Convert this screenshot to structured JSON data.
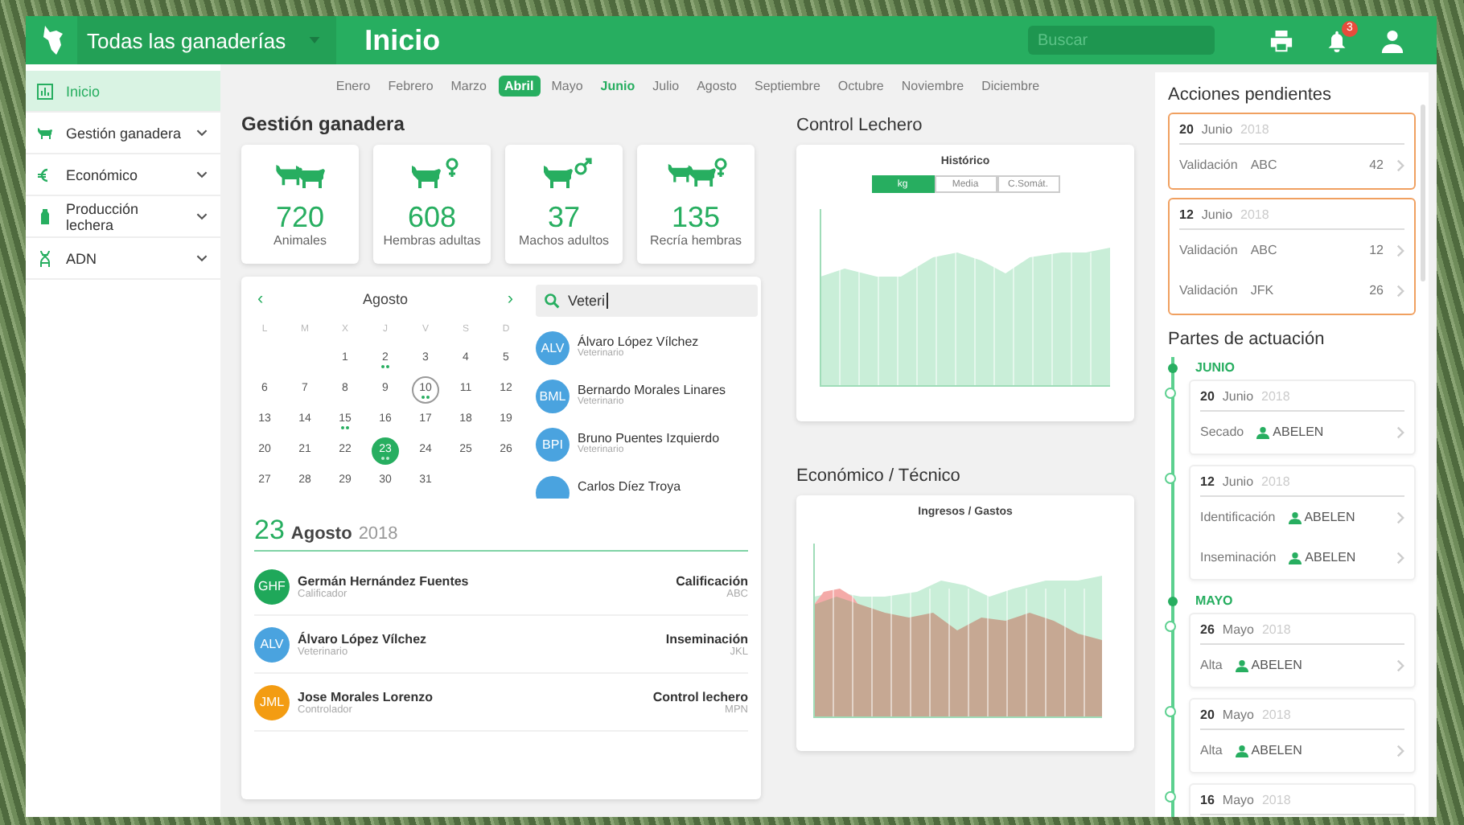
{
  "topbar": {
    "farm_selector": "Todas las ganaderías",
    "title": "Inicio",
    "search": {
      "placeholder": "Buscar"
    },
    "notifications": "3"
  },
  "sidebar": {
    "items": [
      {
        "label": "Inicio",
        "selected": true,
        "expandable": false
      },
      {
        "label": "Gestión ganadera",
        "selected": false,
        "expandable": true
      },
      {
        "label": "Económico",
        "selected": false,
        "expandable": true
      },
      {
        "label": "Producción lechera",
        "selected": false,
        "expandable": true
      },
      {
        "label": "ADN",
        "selected": false,
        "expandable": true
      }
    ]
  },
  "months": [
    {
      "label": "Enero",
      "selected": false,
      "current": false
    },
    {
      "label": "Febrero",
      "selected": false,
      "current": false
    },
    {
      "label": "Marzo",
      "selected": false,
      "current": false
    },
    {
      "label": "Abril",
      "selected": true,
      "current": false
    },
    {
      "label": "Mayo",
      "selected": false,
      "current": false
    },
    {
      "label": "Junio",
      "selected": false,
      "current": true
    },
    {
      "label": "Julio",
      "selected": false,
      "current": false
    },
    {
      "label": "Agosto",
      "selected": false,
      "current": false
    },
    {
      "label": "Septiembre",
      "selected": false,
      "current": false
    },
    {
      "label": "Octubre",
      "selected": false,
      "current": false
    },
    {
      "label": "Noviembre",
      "selected": false,
      "current": false
    },
    {
      "label": "Diciembre",
      "selected": false,
      "current": false
    }
  ],
  "gestion": {
    "title": "Gestión ganadera",
    "stats": [
      {
        "value": "720",
        "label": "Animales"
      },
      {
        "value": "608",
        "label": "Hembras adultas"
      },
      {
        "value": "37",
        "label": "Machos adultos"
      },
      {
        "value": "135",
        "label": "Recría hembras"
      }
    ]
  },
  "calendar": {
    "month": "Agosto",
    "prev": "‹",
    "next": "›",
    "weekdays": [
      "L",
      "M",
      "X",
      "J",
      "V",
      "S",
      "D"
    ],
    "days": [
      {
        "kind": "empty"
      },
      {
        "kind": "empty"
      },
      {
        "kind": "day",
        "label": "1",
        "has_events": false,
        "today": false,
        "selected": false
      },
      {
        "kind": "day",
        "label": "2",
        "has_events": true,
        "today": false,
        "selected": false
      },
      {
        "kind": "day",
        "label": "3",
        "has_events": false,
        "today": false,
        "selected": false
      },
      {
        "kind": "day",
        "label": "4",
        "has_events": false,
        "today": false,
        "selected": false
      },
      {
        "kind": "day",
        "label": "5",
        "has_events": false,
        "today": false,
        "selected": false
      },
      {
        "kind": "day",
        "label": "6",
        "has_events": false,
        "today": false,
        "selected": false
      },
      {
        "kind": "day",
        "label": "7",
        "has_events": false,
        "today": false,
        "selected": false
      },
      {
        "kind": "day",
        "label": "8",
        "has_events": false,
        "today": false,
        "selected": false
      },
      {
        "kind": "day",
        "label": "9",
        "has_events": false,
        "today": false,
        "selected": false
      },
      {
        "kind": "day",
        "label": "10",
        "has_events": true,
        "today": true,
        "selected": false
      },
      {
        "kind": "day",
        "label": "11",
        "has_events": false,
        "today": false,
        "selected": false
      },
      {
        "kind": "day",
        "label": "12",
        "has_events": false,
        "today": false,
        "selected": false
      },
      {
        "kind": "day",
        "label": "13",
        "has_events": false,
        "today": false,
        "selected": false
      },
      {
        "kind": "day",
        "label": "14",
        "has_events": false,
        "today": false,
        "selected": false
      },
      {
        "kind": "day",
        "label": "15",
        "has_events": true,
        "today": false,
        "selected": false
      },
      {
        "kind": "day",
        "label": "16",
        "has_events": false,
        "today": false,
        "selected": false
      },
      {
        "kind": "day",
        "label": "17",
        "has_events": false,
        "today": false,
        "selected": false
      },
      {
        "kind": "day",
        "label": "18",
        "has_events": false,
        "today": false,
        "selected": false
      },
      {
        "kind": "day",
        "label": "19",
        "has_events": false,
        "today": false,
        "selected": false
      },
      {
        "kind": "day",
        "label": "20",
        "has_events": false,
        "today": false,
        "selected": false
      },
      {
        "kind": "day",
        "label": "21",
        "has_events": false,
        "today": false,
        "selected": false
      },
      {
        "kind": "day",
        "label": "22",
        "has_events": false,
        "today": false,
        "selected": false
      },
      {
        "kind": "day",
        "label": "23",
        "has_events": true,
        "today": false,
        "selected": true
      },
      {
        "kind": "day",
        "label": "24",
        "has_events": false,
        "today": false,
        "selected": false
      },
      {
        "kind": "day",
        "label": "25",
        "has_events": false,
        "today": false,
        "selected": false
      },
      {
        "kind": "day",
        "label": "26",
        "has_events": false,
        "today": false,
        "selected": false
      },
      {
        "kind": "day",
        "label": "27",
        "has_events": false,
        "today": false,
        "selected": false
      },
      {
        "kind": "day",
        "label": "28",
        "has_events": false,
        "today": false,
        "selected": false
      },
      {
        "kind": "day",
        "label": "29",
        "has_events": false,
        "today": false,
        "selected": false
      },
      {
        "kind": "day",
        "label": "30",
        "has_events": false,
        "today": false,
        "selected": false
      },
      {
        "kind": "day",
        "label": "31",
        "has_events": false,
        "today": false,
        "selected": false
      }
    ]
  },
  "search": {
    "value": "Veteri",
    "results": [
      {
        "initials": "ALV",
        "name": "Álvaro López Vílchez",
        "role": "Veterinario"
      },
      {
        "initials": "BML",
        "name": "Bernardo Morales Linares",
        "role": "Veterinario"
      },
      {
        "initials": "BPI",
        "name": "Bruno Puentes Izquierdo",
        "role": "Veterinario"
      },
      {
        "name": "Carlos Díez Troya"
      }
    ]
  },
  "agenda": {
    "day": "23",
    "month": "Agosto",
    "year": "2018",
    "entries": [
      {
        "initials": "GHF",
        "color": "#1fa85a",
        "name": "Germán Hernández Fuentes",
        "role": "Calificador",
        "action": "Calificación",
        "code": "ABC"
      },
      {
        "initials": "ALV",
        "color": "#4aa3df",
        "name": "Álvaro López Vílchez",
        "role": "Veterinario",
        "action": "Inseminación",
        "code": "JKL"
      },
      {
        "initials": "JML",
        "color": "#f39c12",
        "name": "Jose Morales Lorenzo",
        "role": "Controlador",
        "action": "Control lechero",
        "code": "MPN"
      }
    ]
  },
  "control_lechero": {
    "title": "Control Lechero",
    "chart_title": "Histórico",
    "toggles": [
      {
        "label": "kg",
        "selected": true
      },
      {
        "label": "Media",
        "selected": false
      },
      {
        "label": "C.Somát.",
        "selected": false
      }
    ]
  },
  "economico": {
    "title": "Económico / Técnico",
    "chart_title": "Ingresos / Gastos"
  },
  "pendientes": {
    "title": "Acciones pendientes",
    "groups": [
      {
        "day": "20",
        "month": "Junio",
        "year": "2018",
        "rows": [
          {
            "label": "Validación",
            "code": "ABC",
            "count": "42"
          }
        ]
      },
      {
        "day": "12",
        "month": "Junio",
        "year": "2018",
        "rows": [
          {
            "label": "Validación",
            "code": "ABC",
            "count": "12"
          },
          {
            "label": "Validación",
            "code": "JFK",
            "count": "26"
          }
        ]
      }
    ]
  },
  "partes": {
    "title": "Partes de actuación",
    "months": [
      {
        "label": "JUNIO",
        "entries": [
          {
            "day": "20",
            "month": "Junio",
            "year": "2018",
            "rows": [
              {
                "action": "Secado",
                "user": "ABELEN"
              }
            ]
          },
          {
            "day": "12",
            "month": "Junio",
            "year": "2018",
            "rows": [
              {
                "action": "Identificación",
                "user": "ABELEN"
              },
              {
                "action": "Inseminación",
                "user": "ABELEN"
              }
            ]
          }
        ]
      },
      {
        "label": "MAYO",
        "entries": [
          {
            "day": "26",
            "month": "Mayo",
            "year": "2018",
            "rows": [
              {
                "action": "Alta",
                "user": "ABELEN"
              }
            ]
          },
          {
            "day": "20",
            "month": "Mayo",
            "year": "2018",
            "rows": [
              {
                "action": "Alta",
                "user": "ABELEN"
              }
            ]
          },
          {
            "day": "16",
            "month": "Mayo",
            "year": "2018"
          }
        ]
      }
    ]
  }
}
